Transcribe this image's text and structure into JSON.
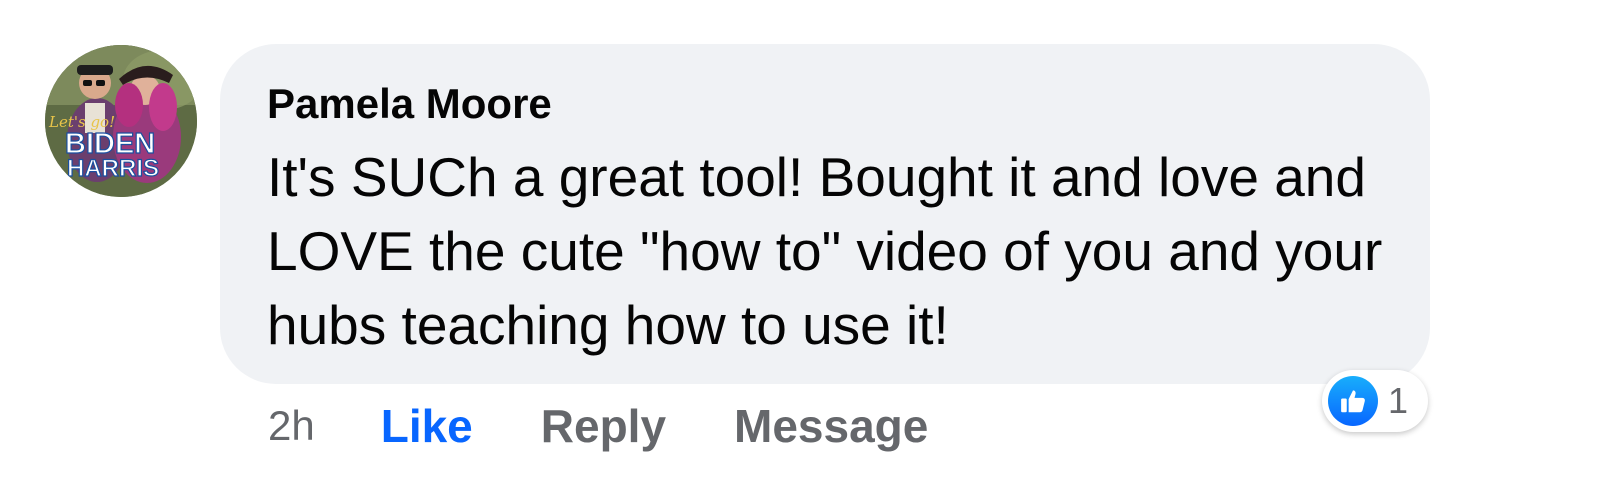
{
  "comment": {
    "avatar": {
      "icon": "profile-photo-avatar",
      "overlay_text_line1": "Let's go!",
      "overlay_text_line2": "BIDEN",
      "overlay_text_line3": "HARRIS"
    },
    "author": "Pamela Moore",
    "text": "It's SUCh a great tool! Bought it and love and LOVE the cute \"how to\" video of you and your hubs teaching how to use it!",
    "timestamp": "2h",
    "actions": {
      "like_label": "Like",
      "reply_label": "Reply",
      "message_label": "Message"
    },
    "reactions": {
      "icon": "thumbs-up-icon",
      "count": "1"
    }
  },
  "colors": {
    "bubble_bg": "#f0f2f5",
    "liked_blue": "#0866ff",
    "secondary_text": "#65676b"
  }
}
